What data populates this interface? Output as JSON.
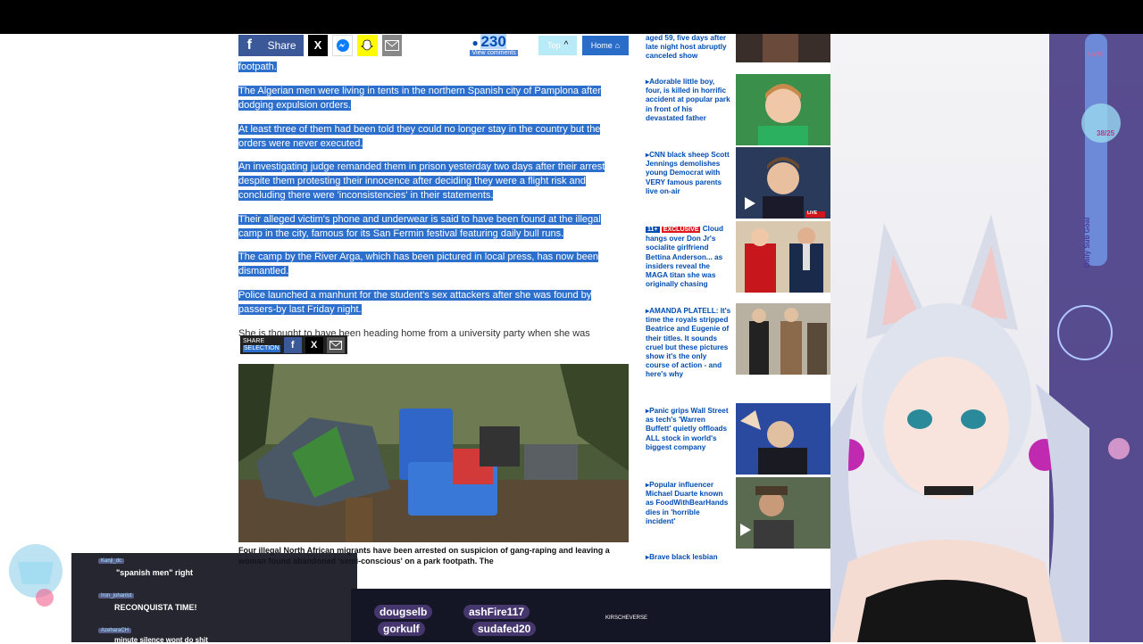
{
  "share_bar": {
    "facebook_icon": "f",
    "share_label": "Share",
    "x_icon": "X",
    "comment_count": "230",
    "comment_sub": "View comments",
    "top_label": "Top",
    "home_label": "Home"
  },
  "article": {
    "paragraphs": [
      "footpath.",
      "The Algerian men were living in tents in the northern Spanish city of Pamplona after dodging expulsion orders.",
      "At least three of them had been told they could no longer stay in the country but the orders were never executed.",
      "An investigating judge remanded them in prison yesterday two days after their arrest despite them protesting their innocence after deciding they were a flight risk and concluding there were 'inconsistencies' in their statements.",
      "Their alleged victim's phone and underwear is said to have been found at the illegal camp in the city, famous for its San Fermin festival featuring daily bull runs.",
      "The camp by the River Arga, which has been pictured in local press, has now been dismantled.",
      "Police launched a manhunt for the student's sex attackers after she was found by passers-by last Friday night."
    ],
    "partial_line": "She is thought to have been heading home from a university party when she was",
    "share_selection_line1": "SHARE",
    "share_selection_line2": "SELECTION",
    "caption": "Four illegal North African migrants have been arrested on suspicion of gang-raping and leaving a woman found abandoned 'semi-conscious' on a park footpath. The"
  },
  "sidebar": {
    "items": [
      {
        "text": "aged 59, five days after late night host abruptly canceled show"
      },
      {
        "text": "Adorable little boy, four, is killed in horrific accident at popular park in front of his devastated father"
      },
      {
        "text": "CNN black sheep Scott Jennings demolishes young Democrat with VERY famous parents live on-air",
        "live": "LIVE"
      },
      {
        "prefix": "11+",
        "badge": "EXCLUSIVE",
        "text": "Cloud hangs over Don Jr's socialite girlfriend Bettina Anderson... as insiders reveal the MAGA titan she was originally chasing"
      },
      {
        "text": "AMANDA PLATELL: It's time the royals stripped Beatrice and Eugenie of their titles. It sounds cruel but these pictures show it's the only course of action - and here's why"
      },
      {
        "text": "Panic grips Wall Street as tech's 'Warren Buffett' quietly offloads ALL stock in world's biggest company"
      },
      {
        "text": "Popular influencer Michael Duarte known as FoodWithBearHands dies in 'horrible incident'"
      },
      {
        "text": "Brave black lesbian"
      }
    ]
  },
  "stream": {
    "chat": [
      {
        "name": "Kanji_dc",
        "message": "\"spanish men\" right"
      },
      {
        "name": "Iron_johanlst",
        "message": "RECONQUISTA TIME!"
      },
      {
        "name": "AzeharaCH",
        "message": "minute silence wont do shit"
      }
    ],
    "ticker": [
      "dougselb",
      "ashFire117",
      "gorkulf",
      "sudafed20"
    ],
    "ticker_right": "KIRSCHEVERSE",
    "daily_goal": "Daily Sub Goal",
    "goal_count": "38/25",
    "live_tag": "LIVE!"
  },
  "colors": {
    "highlight": "#2c6fcd",
    "link_blue": "#004db3",
    "facebook": "#3b5998"
  }
}
